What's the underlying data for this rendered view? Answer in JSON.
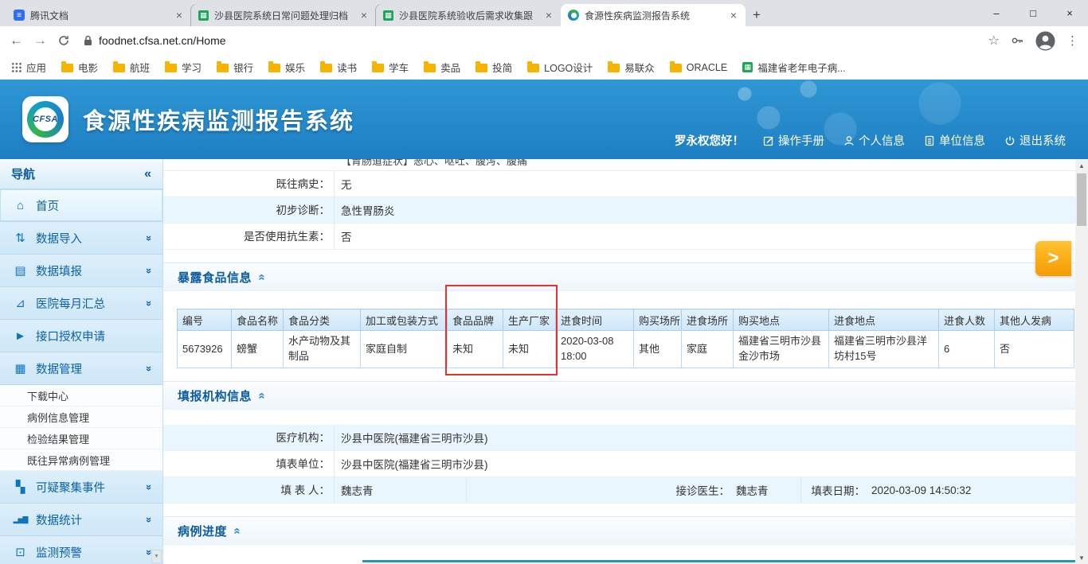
{
  "icons": {
    "tdocs": "≡",
    "sheet": "▦",
    "back": "←",
    "forward": "→",
    "star": "☆",
    "menu": "⋮",
    "minimize": "–",
    "maximize": "□",
    "close": "×",
    "tab_close": "×",
    "new_tab": "+",
    "home": "⌂",
    "data_import": "⇅",
    "data_entry": "▤",
    "monthly_summary": "⊿",
    "interface_auth": "►",
    "data_management": "▦",
    "cluster_event": "▚",
    "statistics": "▂▅▇",
    "monitor_warning": "⊡",
    "chevron_double": "»",
    "collapse_left": "«",
    "section_collapse": "«",
    "scroll_up": "▲",
    "scroll_down": "▼",
    "next_arrow": ">"
  },
  "browser": {
    "tabs": [
      {
        "title": "腾讯文档"
      },
      {
        "title": "沙县医院系统日常问题处理归档"
      },
      {
        "title": "沙县医院系统验收后需求收集跟"
      },
      {
        "title": "食源性疾病监测报告系统"
      }
    ],
    "url": "foodnet.cfsa.net.cn/Home",
    "bookmarks": {
      "apps": "应用",
      "items": [
        "电影",
        "航班",
        "学习",
        "银行",
        "娱乐",
        "读书",
        "学车",
        "卖品",
        "投简",
        "LOGO设计",
        "易联众",
        "ORACLE",
        "福建省老年电子病..."
      ]
    }
  },
  "header": {
    "logo": "CFSA",
    "title": "食源性疾病监测报告系统",
    "greeting": "罗永权您好！",
    "manual": "操作手册",
    "profile": "个人信息",
    "unit": "单位信息",
    "logout": "退出系统"
  },
  "sidebar": {
    "title": "导航",
    "items": [
      {
        "label": "首页"
      },
      {
        "label": "数据导入"
      },
      {
        "label": "数据填报"
      },
      {
        "label": "医院每月汇总"
      },
      {
        "label": "接口授权申请"
      },
      {
        "label": "数据管理"
      },
      {
        "label": "可疑聚集事件"
      },
      {
        "label": "数据统计"
      },
      {
        "label": "监测预警"
      }
    ],
    "submenu": [
      "下载中心",
      "病例信息管理",
      "检验结果管理",
      "既往异常病例管理"
    ]
  },
  "content": {
    "partial_row": "【胃肠道症状】恶心、呕吐、腹泻、腹痛",
    "fields": [
      {
        "label": "既往病史：",
        "value": "无"
      },
      {
        "label": "初步诊断：",
        "value": "急性胃肠炎"
      },
      {
        "label": "是否使用抗生素：",
        "value": "否"
      }
    ],
    "food_section_title": "暴露食品信息",
    "food_table": {
      "headers": [
        "编号",
        "食品名称",
        "食品分类",
        "加工或包装方式",
        "食品品牌",
        "生产厂家",
        "进食时间",
        "购买场所",
        "进食场所",
        "购买地点",
        "进食地点",
        "进食人数",
        "其他人发病"
      ],
      "row": [
        "5673926",
        "螃蟹",
        "水产动物及其制品",
        "家庭自制",
        "未知",
        "未知",
        "2020-03-08 18:00",
        "其他",
        "家庭",
        "福建省三明市沙县金沙市场",
        "福建省三明市沙县洋坊村15号",
        "6",
        "否"
      ]
    },
    "org_section_title": "填报机构信息",
    "org_fields": {
      "row1_label": "医疗机构：",
      "row1_value": "沙县中医院(福建省三明市沙县)",
      "row2_label": "填表单位：",
      "row2_value": "沙县中医院(福建省三明市沙县)",
      "row3_label1": "填 表 人：",
      "row3_value1": "魏志青",
      "row3_label2": "接诊医生：",
      "row3_value2": "魏志青",
      "row3_label3": "填表日期：",
      "row3_value3": "2020-03-09 14:50:32"
    },
    "progress_section_title": "病例进度"
  }
}
